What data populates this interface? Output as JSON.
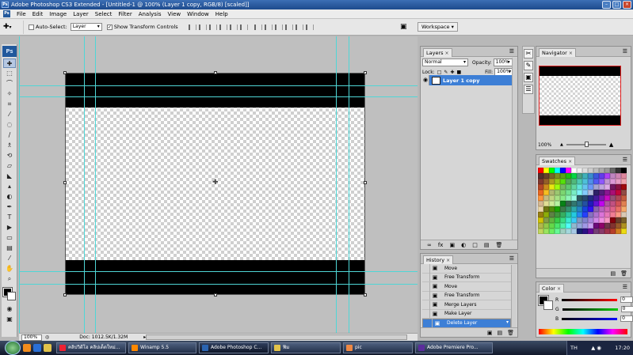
{
  "window": {
    "title": "Adobe Photoshop CS3 Extended - [Untitled-1 @ 100% (Layer 1 copy, RGB/8) [scaled]]",
    "app_icon": "Ps"
  },
  "menus": [
    "File",
    "Edit",
    "Image",
    "Layer",
    "Select",
    "Filter",
    "Analysis",
    "View",
    "Window",
    "Help"
  ],
  "options": {
    "auto_select_label": "Auto-Select:",
    "auto_select_value": "Layer",
    "show_transform_label": "Show Transform Controls",
    "workspace_label": "Workspace"
  },
  "toolbox": {
    "logo": "Ps",
    "tools": [
      {
        "name": "move-tool-icon",
        "glyph": "✚"
      },
      {
        "name": "marquee-tool-icon",
        "glyph": "⬚"
      },
      {
        "name": "lasso-tool-icon",
        "glyph": "⌒"
      },
      {
        "name": "magic-wand-icon",
        "glyph": "✧"
      },
      {
        "name": "crop-tool-icon",
        "glyph": "⌗"
      },
      {
        "name": "eyedropper-icon",
        "glyph": "⁄"
      },
      {
        "name": "healing-brush-icon",
        "glyph": "◌"
      },
      {
        "name": "brush-tool-icon",
        "glyph": "∕"
      },
      {
        "name": "clone-stamp-icon",
        "glyph": "♗"
      },
      {
        "name": "history-brush-icon",
        "glyph": "⟲"
      },
      {
        "name": "eraser-tool-icon",
        "glyph": "▱"
      },
      {
        "name": "paint-bucket-icon",
        "glyph": "◣"
      },
      {
        "name": "blur-tool-icon",
        "glyph": "▴"
      },
      {
        "name": "dodge-tool-icon",
        "glyph": "◐"
      },
      {
        "name": "pen-tool-icon",
        "glyph": "✒"
      },
      {
        "name": "type-tool-icon",
        "glyph": "T"
      },
      {
        "name": "path-select-icon",
        "glyph": "▶"
      },
      {
        "name": "shape-tool-icon",
        "glyph": "▭"
      },
      {
        "name": "notes-tool-icon",
        "glyph": "▤"
      },
      {
        "name": "eyedropper2-icon",
        "glyph": "⁄"
      },
      {
        "name": "hand-tool-icon",
        "glyph": "✋"
      },
      {
        "name": "zoom-tool-icon",
        "glyph": "⌕"
      }
    ]
  },
  "status": {
    "zoom": "100%",
    "doc": "Doc: 1012.5K/1.32M"
  },
  "layers_panel": {
    "tab": "Layers",
    "blend_mode": "Normal",
    "opacity_label": "Opacity:",
    "opacity": "100%",
    "lock_label": "Lock:",
    "fill_label": "Fill:",
    "fill": "100%",
    "layer_name": "Layer 1 copy"
  },
  "navigator": {
    "tab": "Navigator",
    "zoom": "100%"
  },
  "swatches": {
    "tab": "Swatches"
  },
  "history": {
    "tab": "History",
    "items": [
      "Move",
      "Free Transform",
      "Move",
      "Free Transform",
      "Merge Layers",
      "Make Layer",
      "Delete Layer"
    ],
    "selected_index": 6
  },
  "color_panel": {
    "tab": "Color",
    "channels": [
      {
        "label": "R",
        "value": "0",
        "color": "#d11"
      },
      {
        "label": "G",
        "value": "0",
        "color": "#1a1"
      },
      {
        "label": "B",
        "value": "0",
        "color": "#11d"
      }
    ]
  },
  "taskbar": {
    "tasks": [
      "คลิปวิดีโอ คลิปเด็ดใหม่...",
      "Winamp 5.5",
      "Adobe Photoshop C...",
      "ฟิม",
      "pic",
      "Adobe Premiere Pro..."
    ],
    "lang": "TH",
    "time": "17:20"
  },
  "colors": {
    "accent": "#3d7fd6",
    "guide": "#4fd6d6"
  }
}
